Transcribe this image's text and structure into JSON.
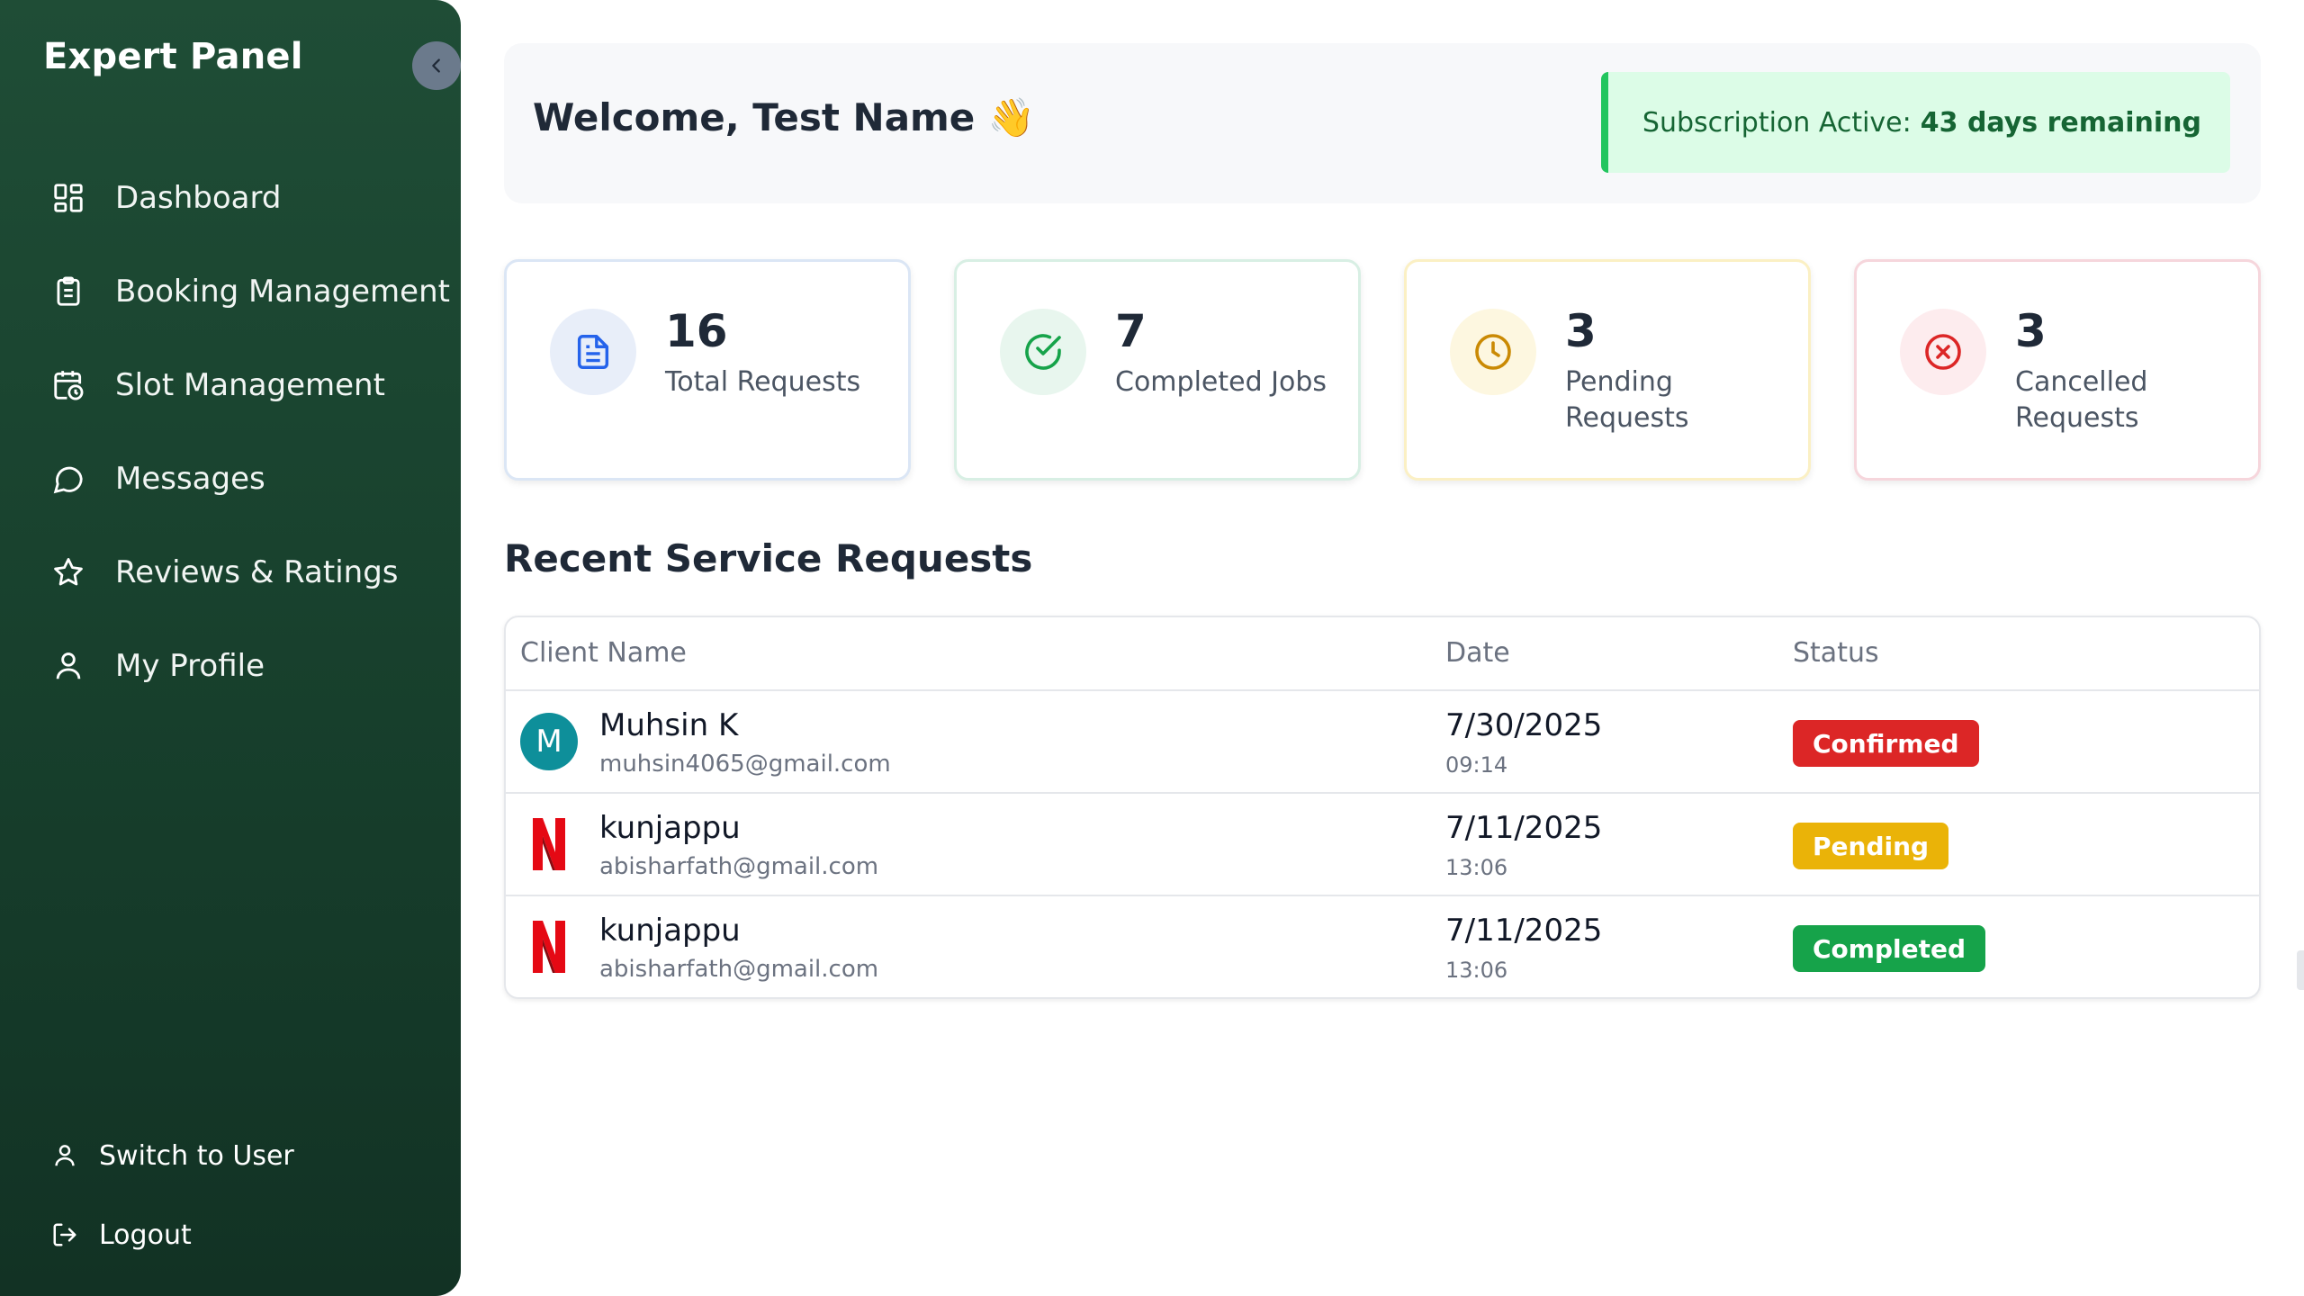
{
  "sidebar": {
    "brand": "Expert Panel",
    "items": [
      {
        "label": "Dashboard",
        "icon": "grid-icon"
      },
      {
        "label": "Booking Management",
        "icon": "clipboard-icon"
      },
      {
        "label": "Slot Management",
        "icon": "calendar-clock-icon"
      },
      {
        "label": "Messages",
        "icon": "chat-bubble-icon"
      },
      {
        "label": "Reviews & Ratings",
        "icon": "star-icon"
      },
      {
        "label": "My Profile",
        "icon": "user-icon"
      }
    ],
    "bottom": {
      "switch_label": "Switch to User",
      "logout_label": "Logout"
    }
  },
  "header": {
    "welcome": "Welcome, Test Name 👋",
    "subscription_prefix": "Subscription Active:",
    "subscription_days": "43 days remaining"
  },
  "stats": [
    {
      "value": "16",
      "label": "Total Requests",
      "color": "#2563eb"
    },
    {
      "value": "7",
      "label": "Completed Jobs",
      "color": "#16a34a"
    },
    {
      "value": "3",
      "label": "Pending Requests",
      "color": "#ca8a04"
    },
    {
      "value": "3",
      "label": "Cancelled Requests",
      "color": "#dc2626"
    }
  ],
  "recent": {
    "title": "Recent Service Requests",
    "columns": [
      "Client Name",
      "Date",
      "Status"
    ],
    "rows": [
      {
        "avatar": "M",
        "name": "Muhsin K",
        "email": "muhsin4065@gmail.com",
        "date": "7/30/2025",
        "time": "09:14",
        "status": "Confirmed"
      },
      {
        "avatar": "N",
        "name": "kunjappu",
        "email": "abisharfath@gmail.com",
        "date": "7/11/2025",
        "time": "13:06",
        "status": "Pending"
      },
      {
        "avatar": "N",
        "name": "kunjappu",
        "email": "abisharfath@gmail.com",
        "date": "7/11/2025",
        "time": "13:06",
        "status": "Completed"
      }
    ]
  },
  "colors": {
    "sidebar": "#1f4d36",
    "accent_green": "#22c55e",
    "confirmed": "#dc2626",
    "pending": "#eab308",
    "completed": "#16a34a"
  }
}
